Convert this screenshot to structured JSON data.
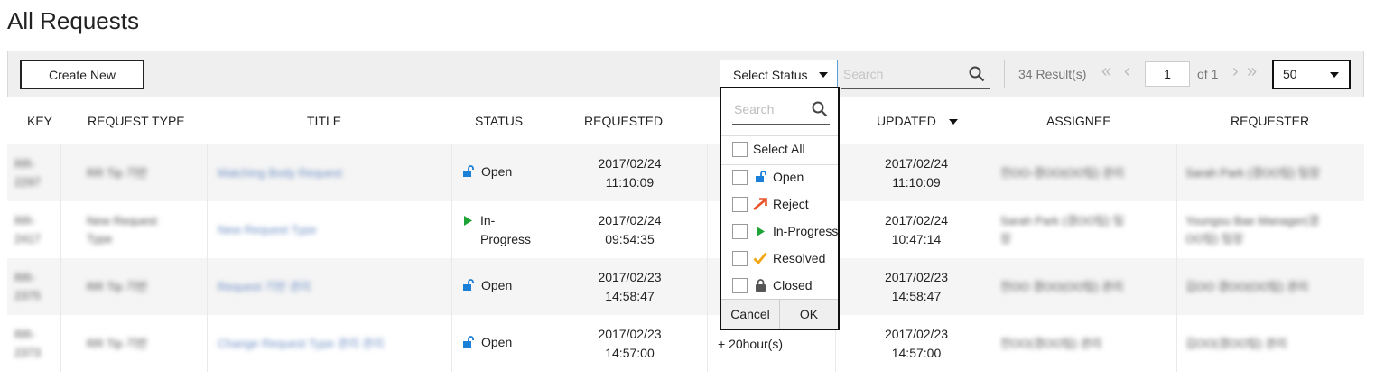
{
  "page": {
    "title": "All Requests"
  },
  "toolbar": {
    "create_label": "Create New",
    "status_select_label": "Select Status",
    "search_placeholder": "Search",
    "results": "34 Result(s)",
    "page_value": "1",
    "of_pages": "of 1",
    "per_page": "50"
  },
  "table": {
    "headers": {
      "key": "KEY",
      "request_type": "REQUEST TYPE",
      "title": "TITLE",
      "status": "STATUS",
      "requested": "REQUESTED",
      "updated": "UPDATED",
      "assignee": "ASSIGNEE",
      "requester": "REQUESTER"
    },
    "rows": [
      {
        "key": "RR-\n2297",
        "type": "RR Tip 기반",
        "title": "Matching Body Request",
        "status": "Open",
        "status_icon": "unlock-icon",
        "requested": "2017/02/24\n11:10:09",
        "elapsed": "",
        "updated": "2017/02/24\n11:10:09",
        "assignee": "전OO-경OO(OO팀) 관리",
        "requester": "Sarah Park (경OO팀) 팀장"
      },
      {
        "key": "RR-\n2417",
        "type": "New Request\nType",
        "title": "New Request Type",
        "status": "In-\nProgress",
        "status_icon": "play-icon",
        "requested": "2017/02/24\n09:54:35",
        "elapsed": "",
        "updated": "2017/02/24\n10:47:14",
        "assignee": "Sarah Park (경OO팀) 팀\n장",
        "requester": "Youngsu Bae Manager(경\nOO팀) 팀장"
      },
      {
        "key": "RR-\n2375",
        "type": "RR Tip 기반",
        "title": "Request 기반 관리",
        "status": "Open",
        "status_icon": "unlock-icon",
        "requested": "2017/02/23\n14:58:47",
        "elapsed": "",
        "updated": "2017/02/23\n14:58:47",
        "assignee": "전OO 경OO(OO팀) 관리",
        "requester": "김OO 경OO(OO팀) 관리"
      },
      {
        "key": "RR-\n2373",
        "type": "RR Tip 기반",
        "title": "Change Request Type 관리 관리",
        "status": "Open",
        "status_icon": "unlock-icon",
        "requested": "2017/02/23\n14:57:00",
        "elapsed": "+ 20hour(s)",
        "updated": "2017/02/23\n14:57:00",
        "assignee": "전OO(경OO팀) 관리",
        "requester": "김OO(경OO팀) 관리"
      }
    ]
  },
  "status_dropdown": {
    "search_placeholder": "Search",
    "select_all": "Select All",
    "options": [
      {
        "label": "Open",
        "icon": "unlock-icon"
      },
      {
        "label": "Reject",
        "icon": "reject-arrow-icon"
      },
      {
        "label": "In-Progress",
        "icon": "play-icon"
      },
      {
        "label": "Resolved",
        "icon": "checkmark-icon"
      },
      {
        "label": "Closed",
        "icon": "lock-icon"
      }
    ],
    "cancel_label": "Cancel",
    "ok_label": "OK"
  },
  "colors": {
    "open_icon": "#1a7fd6",
    "reject_icon": "#e8542a",
    "progress_icon": "#1da336",
    "resolved_icon": "#f2a516",
    "closed_icon": "#555555",
    "link": "#6d8fc4"
  }
}
